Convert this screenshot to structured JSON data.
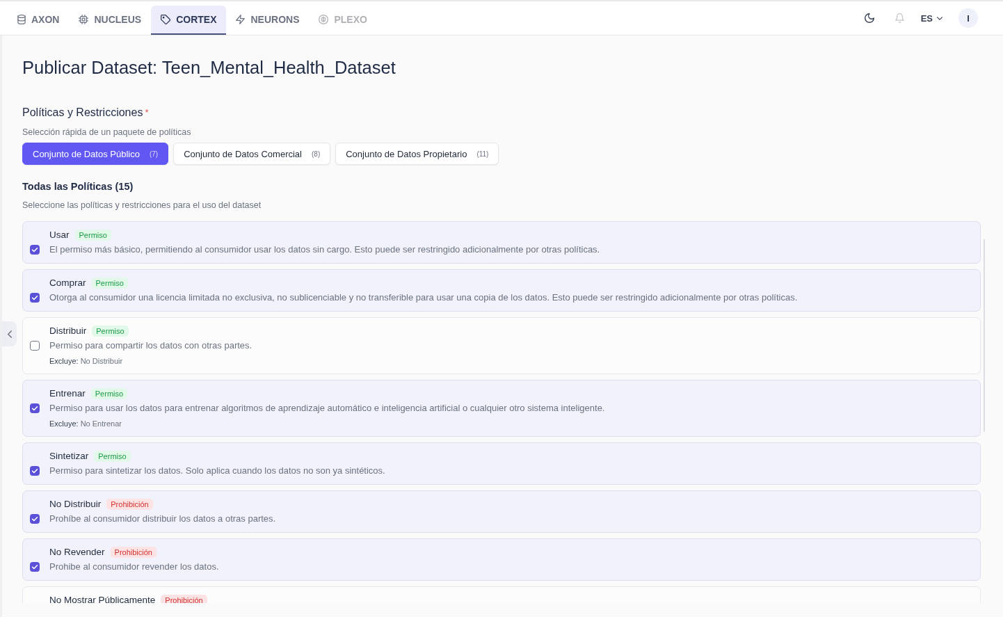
{
  "nav": {
    "tabs": [
      {
        "label": "AXON",
        "selected": false,
        "disabled": false
      },
      {
        "label": "NUCLEUS",
        "selected": false,
        "disabled": false
      },
      {
        "label": "CORTEX",
        "selected": true,
        "disabled": false
      },
      {
        "label": "NEURONS",
        "selected": false,
        "disabled": false
      },
      {
        "label": "PLEXO",
        "selected": false,
        "disabled": true
      }
    ]
  },
  "toolbar": {
    "language": "ES",
    "avatar": "I"
  },
  "page": {
    "title": "Publicar Dataset: Teen_Mental_Health_Dataset"
  },
  "policies": {
    "label": "Políticas y Restricciones",
    "required_mark": "*",
    "presets_hint": "Selección rápida de un paquete de políticas",
    "presets": [
      {
        "label": "Conjunto de Datos Público",
        "count": "(7)",
        "selected": true
      },
      {
        "label": "Conjunto de Datos Comercial",
        "count": "(8)",
        "selected": false
      },
      {
        "label": "Conjunto de Datos Propietario",
        "count": "(11)",
        "selected": false
      }
    ],
    "heading": "Todas las Políticas (15)",
    "hint": "Seleccione las políticas y restricciones para el uso del dataset",
    "items": [
      {
        "name": "Usar",
        "tag": "Permiso",
        "kind": "permission",
        "description": "El permiso más básico, permitiendo al consumidor usar los datos sin cargo. Esto puede ser restringido adicionalmente por otras políticas.",
        "checked": true
      },
      {
        "name": "Comprar",
        "tag": "Permiso",
        "kind": "permission",
        "description": "Otorga al consumidor una licencia limitada no exclusiva, no sublicenciable y no transferible para usar una copia de los datos. Esto puede ser restringido adicionalmente por otras políticas.",
        "checked": true
      },
      {
        "name": "Distribuir",
        "tag": "Permiso",
        "kind": "permission",
        "description": "Permiso para compartir los datos con otras partes.",
        "excludes": "**Excluye:** No Distribuir",
        "checked": false
      },
      {
        "name": "Entrenar",
        "tag": "Permiso",
        "kind": "permission",
        "description": "Permiso para usar los datos para entrenar algoritmos de aprendizaje automático e inteligencia artificial o cualquier otro sistema inteligente.",
        "excludes": "**Excluye:** No Entrenar",
        "checked": true
      },
      {
        "name": "Sintetizar",
        "tag": "Permiso",
        "kind": "permission",
        "description": "Permiso para sintetizar los datos. Solo aplica cuando los datos no son ya sintéticos.",
        "checked": true
      },
      {
        "name": "No Distribuir",
        "tag": "Prohibición",
        "kind": "prohibition",
        "description": "Prohíbe al consumidor distribuir los datos a otras partes.",
        "checked": true
      },
      {
        "name": "No Revender",
        "tag": "Prohibición",
        "kind": "prohibition",
        "description": "Prohibe al consumidor revender los datos.",
        "checked": true
      },
      {
        "name": "No Mostrar Públicamente",
        "tag": "Prohibición",
        "kind": "prohibition"
      }
    ]
  }
}
